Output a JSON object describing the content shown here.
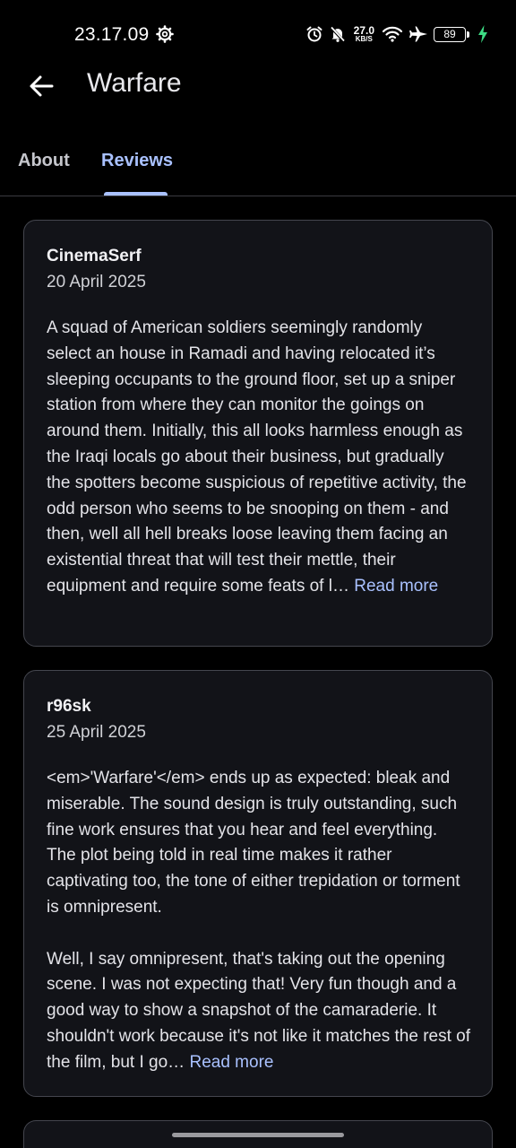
{
  "status_bar": {
    "time": "23.17.09",
    "net_speed_value": "27.0",
    "net_speed_unit": "KB/S",
    "battery_level": "89",
    "charging_color": "#3ddc84"
  },
  "app_bar": {
    "title": "Warfare"
  },
  "tabs": [
    {
      "label": "About",
      "selected": false
    },
    {
      "label": "Reviews",
      "selected": true
    }
  ],
  "accent_color": "#a9c1ff",
  "reviews": [
    {
      "author": "CinemaSerf",
      "date": "20 April 2025",
      "paragraphs": [
        "A squad of American soldiers seemingly randomly select an house in Ramadi and having relocated it’s sleeping occupants to the ground floor, set up a sniper station from where they can monitor the goings on around them. Initially, this all looks harmless enough as the Iraqi locals go about their business, but gradually the spotters become suspicious of repetitive activity, the odd person who seems to be snooping on them - and then, well all hell breaks loose leaving them facing an existential threat that will test their mettle, their equipment and require some feats of l…"
      ],
      "read_more": "Read more"
    },
    {
      "author": "r96sk",
      "date": "25 April 2025",
      "paragraphs": [
        "<em>'Warfare'</em> ends up as expected: bleak and miserable. The sound design is truly outstanding, such fine work ensures that you hear and feel everything. The plot being told in real time makes it rather captivating too, the tone of either trepidation or torment is omnipresent.",
        "Well, I say omnipresent, that's taking out the opening scene. I was not expecting that! Very fun though and a good way to show a snapshot of the camaraderie. It shouldn't work because it's not like it matches the rest of the film, but I go…"
      ],
      "read_more": "Read more"
    }
  ]
}
